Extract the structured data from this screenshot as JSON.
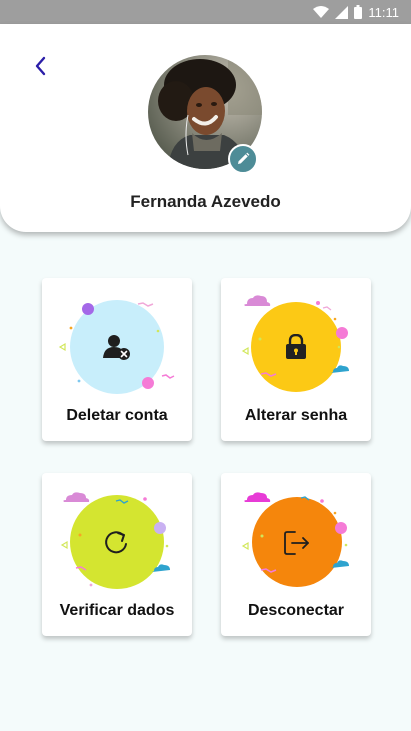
{
  "status_bar": {
    "time": "11:11"
  },
  "profile": {
    "name": "Fernanda Azevedo"
  },
  "actions": [
    {
      "label": "Deletar conta",
      "icon": "remove-user-icon",
      "color": "#c8eefb"
    },
    {
      "label": "Alterar senha",
      "icon": "lock-icon",
      "color": "#fcc915"
    },
    {
      "label": "Verificar dados",
      "icon": "refresh-icon",
      "color": "#d4e530"
    },
    {
      "label": "Desconectar",
      "icon": "logout-icon",
      "color": "#f5860c"
    }
  ],
  "colors": {
    "accent": "#4e8c97",
    "back_arrow": "#2b1ea8",
    "background": "#f4fbfb"
  }
}
